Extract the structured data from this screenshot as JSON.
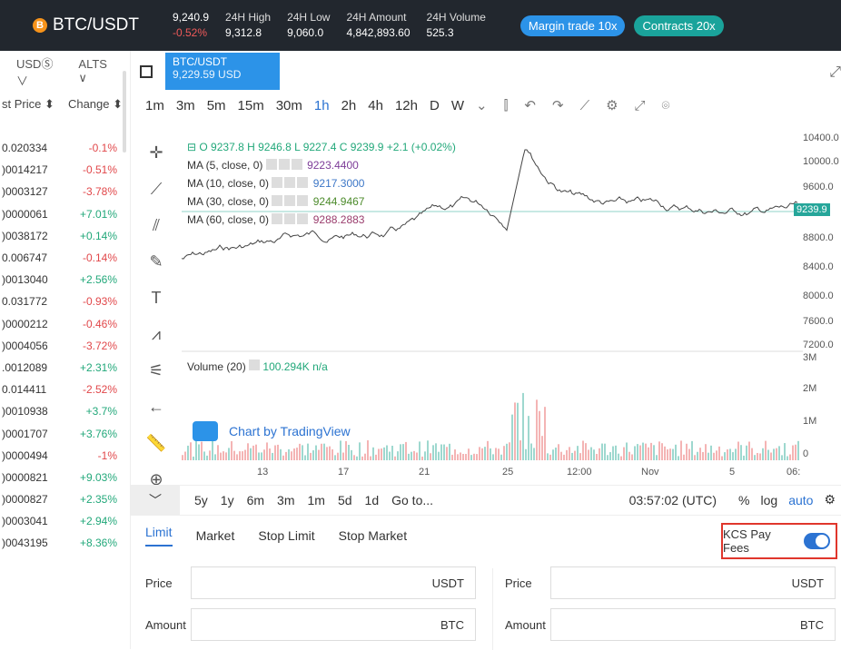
{
  "header": {
    "coin_icon": "B",
    "pair": "BTC/USDT",
    "price": "9,240.9",
    "change": "-0.52%",
    "stats": [
      {
        "label": "24H High",
        "value": "9,312.8"
      },
      {
        "label": "24H Low",
        "value": "9,060.0"
      },
      {
        "label": "24H Amount",
        "value": "4,842,893.60"
      },
      {
        "label": "24H Volume",
        "value": "525.3"
      }
    ],
    "margin_btn": "Margin trade 10x",
    "contracts_btn": "Contracts 20x",
    "colors": {
      "bg": "#22272e",
      "margin": "#2c93e8",
      "contracts": "#1aa39b",
      "neg": "#f05a5a"
    }
  },
  "market_filter": {
    "usds": "USDⓈ ∨",
    "alts": "ALTS ∨"
  },
  "market_list": {
    "col_price": "st Price ⬍",
    "col_change": "Change ⬍",
    "rows": [
      {
        "price": "0.020334",
        "change": "-0.1%",
        "dir": "neg"
      },
      {
        "price": ")0014217",
        "change": "-0.51%",
        "dir": "neg"
      },
      {
        "price": ")0003127",
        "change": "-3.78%",
        "dir": "neg"
      },
      {
        "price": ")0000061",
        "change": "+7.01%",
        "dir": "pos"
      },
      {
        "price": ")0038172",
        "change": "+0.14%",
        "dir": "pos"
      },
      {
        "price": "0.006747",
        "change": "-0.14%",
        "dir": "neg"
      },
      {
        "price": ")0013040",
        "change": "+2.56%",
        "dir": "pos"
      },
      {
        "price": "0.031772",
        "change": "-0.93%",
        "dir": "neg"
      },
      {
        "price": ")0000212",
        "change": "-0.46%",
        "dir": "neg"
      },
      {
        "price": ")0004056",
        "change": "-3.72%",
        "dir": "neg"
      },
      {
        "price": ".0012089",
        "change": "+2.31%",
        "dir": "pos"
      },
      {
        "price": "0.014411",
        "change": "-2.52%",
        "dir": "neg"
      },
      {
        "price": ")0010938",
        "change": "+3.7%",
        "dir": "pos"
      },
      {
        "price": ")0001707",
        "change": "+3.76%",
        "dir": "pos"
      },
      {
        "price": ")0000494",
        "change": "-1%",
        "dir": "neg"
      },
      {
        "price": ")0000821",
        "change": "+9.03%",
        "dir": "pos"
      },
      {
        "price": ")0000827",
        "change": "+2.35%",
        "dir": "pos"
      },
      {
        "price": ")0003041",
        "change": "+2.94%",
        "dir": "pos"
      },
      {
        "price": ")0043195",
        "change": "+8.36%",
        "dir": "pos"
      }
    ]
  },
  "chart_tab": {
    "pair": "BTC/USDT",
    "price": "9,229.59 USD"
  },
  "intervals": [
    "1m",
    "3m",
    "5m",
    "15m",
    "30m",
    "1h",
    "2h",
    "4h",
    "12h",
    "D",
    "W"
  ],
  "active_interval": "1h",
  "legend": {
    "ohlc": "⊟ O 9237.8  H 9246.8  L 9227.4  C 9239.9  +2.1 (+0.02%)",
    "mas": [
      {
        "label": "MA (5, close, 0)",
        "value": "9223.4400"
      },
      {
        "label": "MA (10, close, 0)",
        "value": "9217.3000"
      },
      {
        "label": "MA (30, close, 0)",
        "value": "9244.9467"
      },
      {
        "label": "MA (60, close, 0)",
        "value": "9288.2883"
      }
    ],
    "volume": "Volume (20)",
    "volume_value": "100.294K  n/a"
  },
  "price_axis": [
    "10400.0",
    "10000.0",
    "9600.0",
    "9239.9",
    "8800.0",
    "8400.0",
    "8000.0",
    "7600.0",
    "7200.0"
  ],
  "vol_axis": [
    "3M",
    "2M",
    "1M",
    "0"
  ],
  "time_axis": [
    "13",
    "17",
    "21",
    "25",
    "12:00",
    "Nov",
    "5",
    "06:"
  ],
  "tv_logo": "Chart by TradingView",
  "range_bar": {
    "ranges": [
      "5y",
      "1y",
      "6m",
      "3m",
      "1m",
      "5d",
      "1d"
    ],
    "goto": "Go to...",
    "time": "03:57:02 (UTC)",
    "pct": "%",
    "log": "log",
    "auto": "auto"
  },
  "order": {
    "tabs": [
      "Limit",
      "Market",
      "Stop Limit",
      "Stop Market"
    ],
    "active_tab": "Limit",
    "kcs": "KCS Pay Fees",
    "price_label": "Price",
    "amount_label": "Amount",
    "usdt": "USDT",
    "btc": "BTC"
  }
}
